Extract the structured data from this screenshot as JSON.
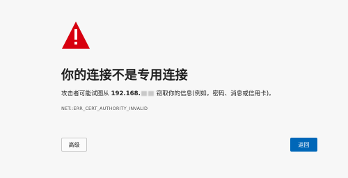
{
  "page": {
    "background": "#f7f7f7"
  },
  "icons": {
    "warning": "warning-triangle-icon",
    "warning_color": "#d7000f"
  },
  "error": {
    "title": "你的连接不是专用连接",
    "message_prefix": "攻击者可能试图从",
    "host": "192.168.",
    "message_suffix": "窃取你的信息(例如，密码、消息或信用卡)。",
    "code": "NET::ERR_CERT_AUTHORITY_INVALID"
  },
  "buttons": {
    "advanced": "高级",
    "back": "返回",
    "back_color": "#0067b8"
  }
}
